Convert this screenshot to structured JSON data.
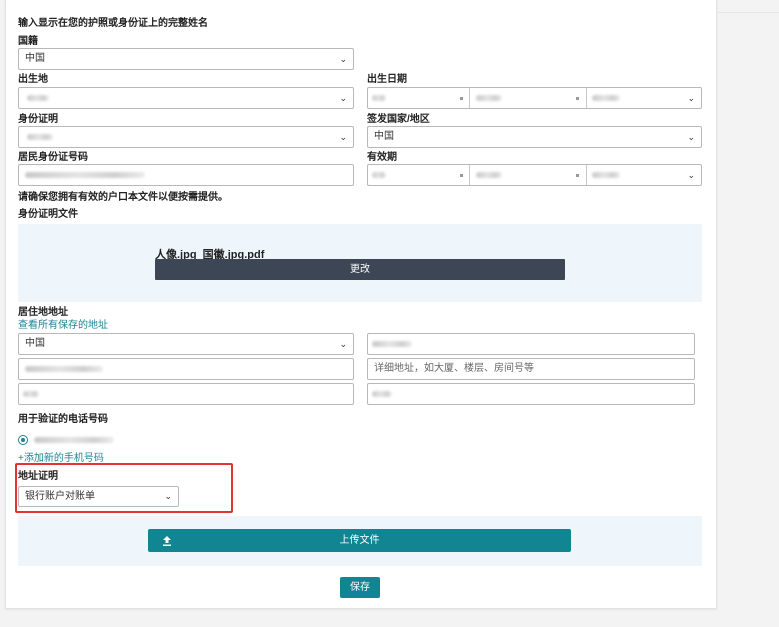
{
  "form": {
    "name_hint": "输入显示在您的护照或身份证上的完整姓名",
    "nationality": {
      "label": "国籍",
      "value": "中国"
    },
    "birthplace": {
      "label": "出生地"
    },
    "birthdate": {
      "label": "出生日期"
    },
    "id_type": {
      "label": "身份证明"
    },
    "issuing_country": {
      "label": "签发国家/地区",
      "value": "中国"
    },
    "id_number": {
      "label": "居民身份证号码"
    },
    "expiry": {
      "label": "有效期"
    },
    "hukou_note": "请确保您拥有有效的户口本文件以便按需提供。",
    "id_document": {
      "label": "身份证明文件",
      "file_name": "人像.jpg_国徽.jpg.pdf",
      "change_button": "更改"
    },
    "address": {
      "label": "居住地地址",
      "saved_link": "查看所有保存的地址",
      "country_value": "中国",
      "detail_placeholder": "详细地址，如大厦、楼层、房间号等"
    },
    "phone": {
      "label": "用于验证的电话号码",
      "add_link": "+添加新的手机号码"
    },
    "address_proof": {
      "label": "地址证明",
      "value": "银行账户对账单",
      "upload_button": "上传文件"
    },
    "save_button": "保存"
  },
  "colors": {
    "accent": "#118592",
    "link": "#1e8494",
    "dark_button": "#3c4654",
    "highlight": "#e5332f",
    "upload_bg": "#eef6fb"
  }
}
